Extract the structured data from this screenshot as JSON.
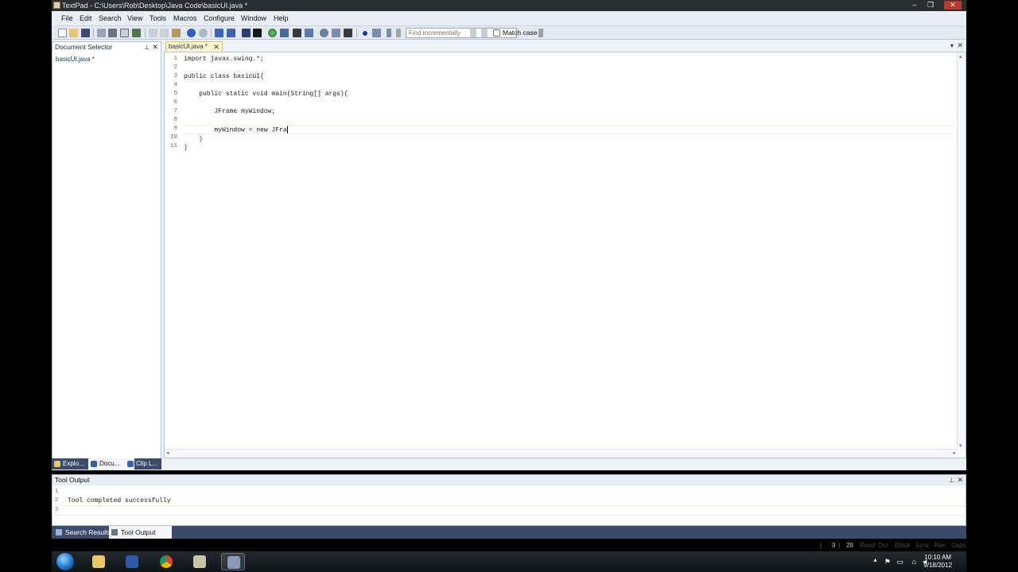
{
  "window": {
    "title": "TextPad - C:\\Users\\Rob\\Desktop\\Java Code\\basicUI.java *",
    "min_label": "‒",
    "restore_label": "❐",
    "close_label": "✕"
  },
  "menu": [
    "File",
    "Edit",
    "Search",
    "View",
    "Tools",
    "Macros",
    "Configure",
    "Window",
    "Help"
  ],
  "toolbar": {
    "find_placeholder": "Find incrementally",
    "match_case_label": "Match case"
  },
  "document_selector": {
    "title": "Document Selector",
    "pin_label": "⊥",
    "close_label": "✕",
    "items": [
      "basicUI.java *"
    ],
    "tabs": [
      "Explo...",
      "Docu...",
      "Clip L..."
    ]
  },
  "editor": {
    "tab_label": "basicUI.java *",
    "tab_close": "✕",
    "line_numbers": [
      "1",
      "2",
      "3",
      "4",
      "5",
      "6",
      "7",
      "8",
      "9",
      "10",
      "11"
    ],
    "lines": [
      "import javax.swing.*;",
      "",
      "public class basicUI{",
      "",
      "    public static void main(String[] args){",
      "",
      "        JFrame myWindow;",
      "",
      "        myWindow = new JFra",
      "    }",
      "}"
    ],
    "current_line_index": 8
  },
  "tool_output": {
    "title": "Tool Output",
    "pin_label": "⊥",
    "close_label": "✕",
    "lines": [
      {
        "n": "1",
        "text": ""
      },
      {
        "n": "2",
        "text": "Tool completed successfully"
      },
      {
        "n": "3",
        "text": ""
      }
    ]
  },
  "bottom_tabs": [
    "Search Results",
    "Tool Output"
  ],
  "status": {
    "line": "9",
    "col": "28",
    "read": "Read",
    "ovr": "Ovr",
    "block": "Block",
    "sync": "Sync",
    "rec": "Rec",
    "caps": "Caps"
  },
  "taskbar": {
    "time": "10:10 AM",
    "date": "9/18/2012"
  }
}
